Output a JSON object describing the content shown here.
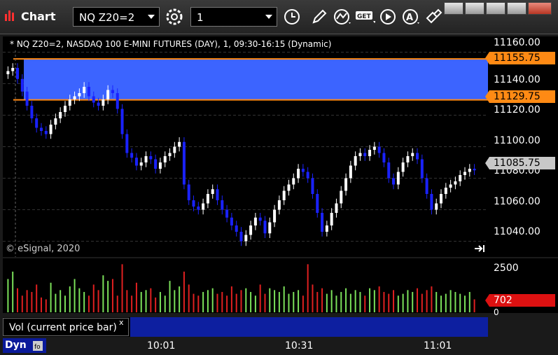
{
  "titlebar": {
    "title": "Chart",
    "symbol": "NQ Z20=2",
    "interval": "1"
  },
  "chart": {
    "header": "* NQ Z20=2, NASDAQ 100 E-MINI FUTURES (DAY), 1, 09:30-16:15 (Dynamic)",
    "watermark": "© eSignal, 2020",
    "price_labels": [
      "11160.00",
      "11140.00",
      "11120.00",
      "11100.00",
      "11080.00",
      "11060.00",
      "11040.00"
    ],
    "tags": {
      "upper": "11155.75",
      "lower": "11129.75",
      "last": "11085.75"
    },
    "colors": {
      "up": "#ffffff",
      "down": "#1a22ff",
      "zone": "#3c64ff",
      "zone_line": "#ff8a14"
    }
  },
  "volume": {
    "labels": [
      "2500",
      "0"
    ],
    "current": "702",
    "colors": {
      "up": "#7be05a",
      "down": "#e02020"
    }
  },
  "legend": {
    "label": "Vol (current price bar)",
    "close": "x"
  },
  "footer": {
    "mode": "Dyn"
  },
  "time_labels": [
    "10:01",
    "10:31",
    "11:01"
  ],
  "chart_data": {
    "type": "candlestick",
    "y_range": [
      11030,
      11170
    ],
    "zone": [
      11129.75,
      11155.75
    ],
    "last_price": 11085.75,
    "candles_close": [
      11148,
      11150,
      11143,
      11135,
      11126,
      11118,
      11112,
      11110,
      11108,
      11114,
      11118,
      11122,
      11126,
      11130,
      11132,
      11134,
      11138,
      11132,
      11128,
      11126,
      11130,
      11136,
      11134,
      11124,
      11108,
      11096,
      11093,
      11088,
      11090,
      11094,
      11092,
      11086,
      11090,
      11094,
      11096,
      11100,
      11103,
      11076,
      11066,
      11062,
      11060,
      11064,
      11070,
      11073,
      11066,
      11060,
      11055,
      11050,
      11046,
      11040,
      11044,
      11050,
      11055,
      11053,
      11045,
      11052,
      11060,
      11066,
      11072,
      11076,
      11080,
      11086,
      11084,
      11080,
      11070,
      11058,
      11046,
      11050,
      11058,
      11064,
      11072,
      11080,
      11088,
      11094,
      11096,
      11094,
      11098,
      11100,
      11096,
      11090,
      11080,
      11076,
      11084,
      11090,
      11094,
      11096,
      11092,
      11080,
      11070,
      11060,
      11064,
      11070,
      11074,
      11076,
      11078,
      11082,
      11084,
      11086,
      11085
    ],
    "volume_max": 2500,
    "volume_current": 702
  }
}
